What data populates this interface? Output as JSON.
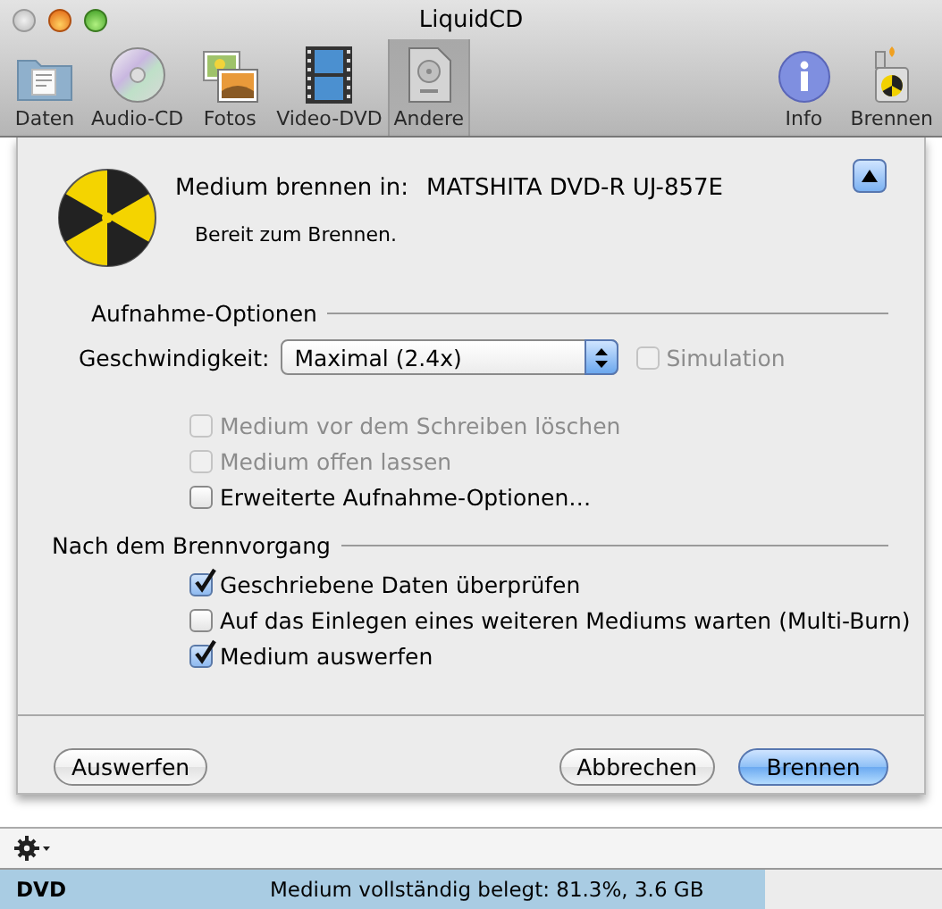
{
  "window": {
    "title": "LiquidCD"
  },
  "toolbar": {
    "items": [
      {
        "label": "Daten",
        "selected": false
      },
      {
        "label": "Audio-CD",
        "selected": false
      },
      {
        "label": "Fotos",
        "selected": false
      },
      {
        "label": "Video-DVD",
        "selected": false
      },
      {
        "label": "Andere",
        "selected": true
      }
    ],
    "right_items": [
      {
        "label": "Info"
      },
      {
        "label": "Brennen"
      }
    ]
  },
  "sheet": {
    "destination_label": "Medium brennen in:",
    "drive": "MATSHITA DVD-R UJ-857E",
    "status": "Bereit zum Brennen.",
    "sections": [
      {
        "title": "Aufnahme-Optionen",
        "rows": [
          {
            "kind": "popup",
            "label": "Geschwindigkeit:",
            "value": "Maximal (2.4x)",
            "option": {
              "label": "Simulation",
              "checked": false,
              "disabled": true
            }
          },
          {
            "kind": "checkbox",
            "label": "Medium vor dem Schreiben löschen",
            "checked": false,
            "disabled": true
          },
          {
            "kind": "checkbox",
            "label": "Medium offen lassen",
            "checked": false,
            "disabled": true
          },
          {
            "kind": "checkbox",
            "label": "Erweiterte Aufnahme-Optionen…",
            "checked": false,
            "disabled": false
          }
        ]
      },
      {
        "title": "Nach dem Brennvorgang",
        "rows": [
          {
            "kind": "checkbox",
            "label": "Geschriebene Daten überprüfen",
            "checked": true,
            "disabled": false
          },
          {
            "kind": "checkbox",
            "label": "Auf das Einlegen eines weiteren Mediums warten (Multi-Burn)",
            "checked": false,
            "disabled": false
          },
          {
            "kind": "checkbox",
            "label": "Medium auswerfen",
            "checked": true,
            "disabled": false
          }
        ]
      }
    ],
    "left_buttons": [
      {
        "label": "Auswerfen",
        "default": false
      }
    ],
    "right_buttons": [
      {
        "label": "Abbrechen",
        "default": false
      },
      {
        "label": "Brennen",
        "default": true
      }
    ]
  },
  "status_bar": {
    "media": "DVD",
    "text": "Medium vollständig belegt: 81.3%, 3.6 GB",
    "level": 0.813
  }
}
